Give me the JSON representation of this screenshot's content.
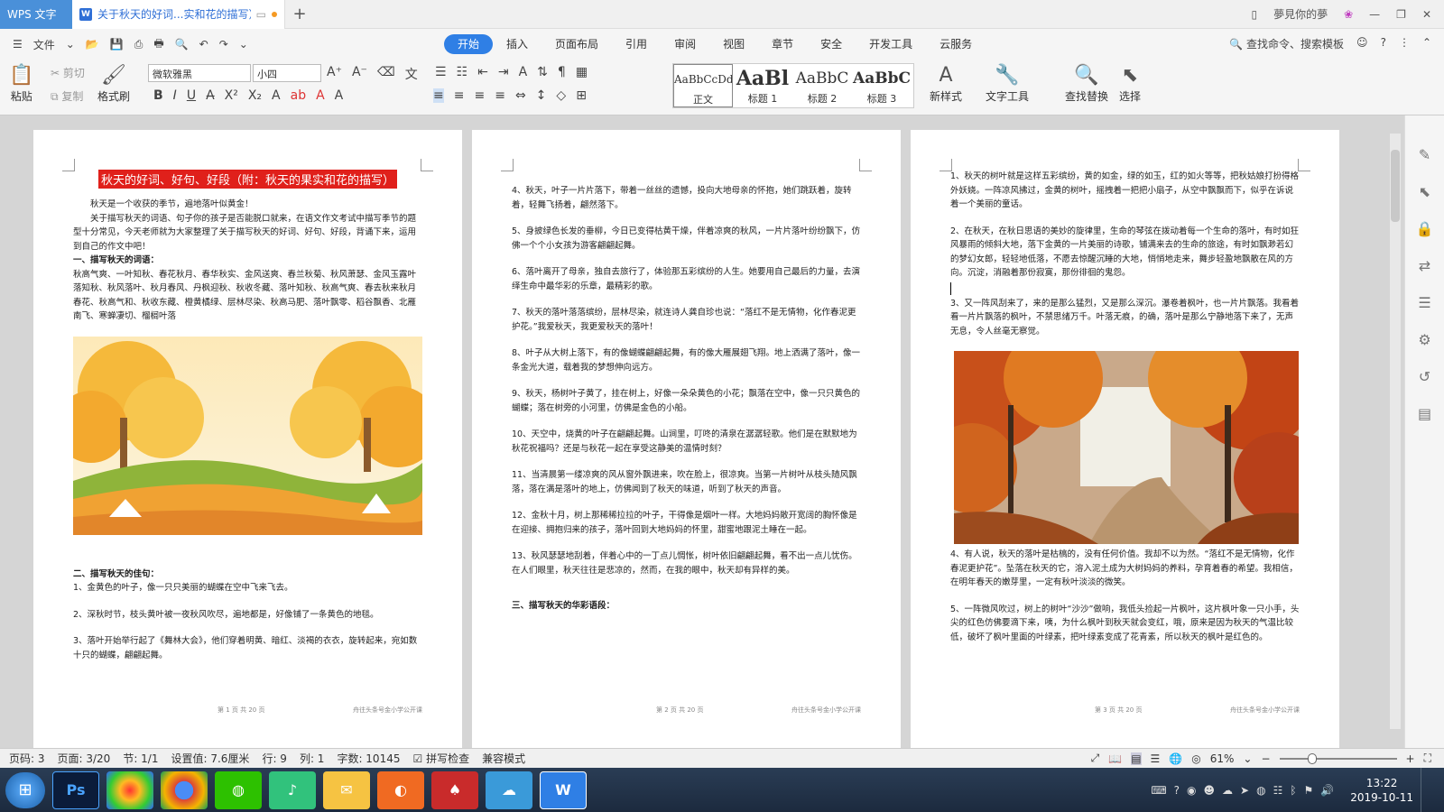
{
  "titlebar": {
    "app_label": "WPS 文字",
    "doc_tab_title": "关于秋天的好词...实和花的描写）",
    "new_tab": "+",
    "user_name": "夢見你的夢",
    "icons": [
      "book-icon",
      "minimize-icon",
      "restore-icon",
      "close-icon"
    ]
  },
  "menu": {
    "file_label": "文件",
    "tabs": [
      "开始",
      "插入",
      "页面布局",
      "引用",
      "审阅",
      "视图",
      "章节",
      "安全",
      "开发工具",
      "云服务"
    ],
    "active_tab": "开始",
    "search_label": "查找命令、搜索模板"
  },
  "ribbon": {
    "paste": "粘贴",
    "cut": "剪切",
    "copy": "复制",
    "format_painter": "格式刷",
    "font_name": "微软雅黑",
    "font_size": "小四",
    "styles": [
      {
        "preview": "AaBbCcDd",
        "label": "正文"
      },
      {
        "preview": "AaBl",
        "label": "标题 1"
      },
      {
        "preview": "AaBbC",
        "label": "标题 2"
      },
      {
        "preview": "AaBbC",
        "label": "标题 3"
      }
    ],
    "new_style": "新样式",
    "text_tools": "文字工具",
    "find_replace": "查找替换",
    "select": "选择"
  },
  "pages": {
    "p1": {
      "title": "秋天的好词、好句、好段（附：秋天的果实和花的描写）",
      "intro1": "秋天是一个收获的季节，遍地落叶似黄金！",
      "intro2": "关于描写秋天的词语、句子你的孩子是否能脱口就来，在语文作文考试中描写季节的题型十分常见，今天老师就为大家整理了关于描写秋天的好词、好句、好段，背诵下来，运用到自己的作文中吧！",
      "h_words": "一、描写秋天的词语：",
      "words": "秋高气爽、一叶知秋、春花秋月、春华秋实、金风送爽、春兰秋菊、秋风萧瑟、金风玉露叶落知秋、秋风落叶、秋月春风、丹枫迎秋、秋收冬藏、落叶知秋、秋高气爽、春去秋来秋月春花、秋高气和、秋收东藏、橙黄橘绿、层林尽染、秋高马肥、落叶飘零、稻谷飘香、北雁南飞、寒蝉凄切、榴榈叶落",
      "h_sent": "二、描写秋天的佳句：",
      "s1": "1、金黄色的叶子，像一只只美丽的蝴蝶在空中飞来飞去。",
      "s2": "2、深秋时节，枝头黄叶被一夜秋风吹尽，遍地都是，好像铺了一条黄色的地毯。",
      "s3": "3、落叶开始举行起了《舞林大会》，他们穿着明黄、暗红、淡褐的衣衣，旋转起来，宛如数十只的蝴蝶，翩翩起舞。",
      "footer_page": "第 1 页 共 20 页",
      "footer_right": "舟往头条号金小学公开课"
    },
    "p2": {
      "s4": "4、秋天，叶子一片片落下，带着一丝丝的遗憾，投向大地母亲的怀抱，她们跳跃着，旋转着，轻舞飞扬着，翩然落下。",
      "s5": "5、身披绿色长发的垂柳，今日已变得枯黄干燥，伴着凉爽的秋风，一片片落叶纷纷飘下，仿佛一个个小女孩为游客翩翩起舞。",
      "s6": "6、落叶离开了母亲，独自去旅行了，体验那五彩缤纷的人生。她要用自己最后的力量，去演绎生命中最华彩的乐章，最精彩的歌。",
      "s7": "7、秋天的落叶落落缤纷，层林尽染，就连诗人龚自珍也说：“落红不是无情物，化作春泥更护花。”我爱秋天，我更爱秋天的落叶！",
      "s8": "8、叶子从大树上落下，有的像蝴蝶翩翩起舞，有的像大雁展翅飞翔。地上洒满了落叶，像一条金光大道，载着我的梦想伸向远方。",
      "s9": "9、秋天，杨树叶子黄了，挂在树上，好像一朵朵黄色的小花；飘落在空中，像一只只黄色的蝴蝶；落在树旁的小河里，仿佛是金色的小船。",
      "s10": "10、天空中，烧黄的叶子在翩翩起舞。山涧里，叮咚的清泉在潺潺轻歌。他们是在默默地为秋花祝福吗？还是与秋花一起在享受这静美的温情时刻？",
      "s11": "11、当清晨第一缕凉爽的风从窗外飘进来，吹在脸上，很凉爽。当第一片树叶从枝头随风飘落，落在满是落叶的地上，仿佛闻到了秋天的味道，听到了秋天的声音。",
      "s12": "12、金秋十月，树上那稀稀拉拉的叶子，干得像是烟叶一样。大地妈妈敞开宽阔的胸怀像是在迎接、拥抱归来的孩子，落叶回到大地妈妈的怀里，甜蜜地跟泥土睡在一起。",
      "s13": "13、秋风瑟瑟地刮着，伴着心中的一丁点儿惆怅，树叶依旧翩翩起舞，看不出一点儿忧伤。在人们眼里，秋天往往是悲凉的，然而，在我的眼中，秋天却有异样的美。",
      "h_para": "三、描写秋天的华彩语段：",
      "footer_page": "第 2 页 共 20 页",
      "footer_right": "舟往头条号金小学公开课"
    },
    "p3": {
      "t1": "1、秋天的树叶就是这样五彩缤纷，黄的如金，绿的如玉，红的如火等等，把秋姑娘打扮得格外妖娆。一阵凉风拂过，金黄的树叶，摇拽着一把把小扇子，从空中飘飘而下，似乎在诉说着一个美丽的童话。",
      "t2": "2、在秋天，在秋日思语的美妙的旋律里，生命的琴弦在拨动着每一个生命的落叶，有时如狂风暴雨的倾斜大地，落下金黄的一片美丽的诗歌，铺满来去的生命的旅途，有时如飘渺若幻的梦幻女郎，轻轻地低落，不愿去惊醒沉睡的大地，悄悄地走来，舞步轻盈地飘散在风的方向。沉淀，消融着那份寂寞，那份徘徊的鬼怨。",
      "t3": "3、又一阵风刮来了，来的是那么猛烈，又是那么深沉。瀑卷着枫叶，也一片片飘落。我看着看一片片飘落的枫叶，不禁思绪万千。叶落无痕，的确，落叶是那么宁静地落下来了，无声无息，令人丝毫无察觉。",
      "t4": "4、有人说，秋天的落叶是枯槁的，没有任何价值。我却不以为然。“落红不是无情物，化作春泥更护花”。坠落在秋天的它，溶入泥土成为大树妈妈的养料，孕育着春的希望。我相信，在明年春天的嫩芽里，一定有秋叶淡淡的微笑。",
      "t5": "5、一阵微风吹过，树上的树叶“沙沙”做响，我低头捡起一片枫叶，这片枫叶象一只小手，头尖的红色仿佛要滴下来，咦，为什么枫叶到秋天就会变红，哦，原来是因为秋天的气温比较低，破坏了枫叶里面的叶绿素，把叶绿素变成了花青素，所以秋天的枫叶是红色的。",
      "footer_page": "第 3 页 共 20 页",
      "footer_right": "舟往头条号金小学公开课"
    }
  },
  "status": {
    "page_num": "页码: 3",
    "pages": "页面: 3/20",
    "section": "节: 1/1",
    "setting": "设置值: 7.6厘米",
    "row": "行: 9",
    "col": "列: 1",
    "words": "字数: 10145",
    "spell": "拼写检查",
    "compat": "兼容模式",
    "zoom": "61%",
    "zoom_level": 0.28
  },
  "taskbar": {
    "time": "13:22",
    "date": "2019-10-11",
    "apps": [
      "Ps",
      "",
      "",
      "",
      "",
      "",
      "",
      ""
    ]
  }
}
